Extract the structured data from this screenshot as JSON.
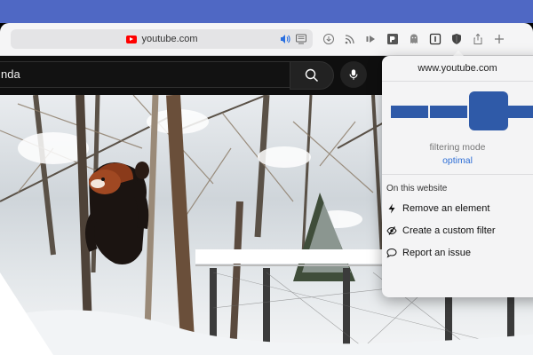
{
  "browser": {
    "address": {
      "url": "youtube.com"
    },
    "toolbar_icons": [
      "download-icon",
      "rss-icon",
      "forward-icon",
      "puzzle-extension-icon",
      "ghostery-icon",
      "sidebar-icon",
      "shield-icon",
      "share-icon",
      "new-tab-icon"
    ]
  },
  "youtube": {
    "search_value": "nda"
  },
  "popover": {
    "hostname": "www.youtube.com",
    "mode_label": "filtering mode",
    "mode_value": "optimal",
    "slider_level": 3,
    "slider_levels": 4,
    "section_title": "On this website",
    "actions": [
      {
        "icon": "lightning-icon",
        "label": "Remove an element"
      },
      {
        "icon": "eye-dropper-icon",
        "label": "Create a custom filter"
      },
      {
        "icon": "speech-bubble-icon",
        "label": "Report an issue"
      }
    ],
    "accent_color": "#2f5aa8",
    "link_color": "#2f6fd6"
  },
  "colors": {
    "desktop": "#4f68c4",
    "toolbar": "#f5f5f6",
    "youtube_bg": "#0f0f0f"
  }
}
